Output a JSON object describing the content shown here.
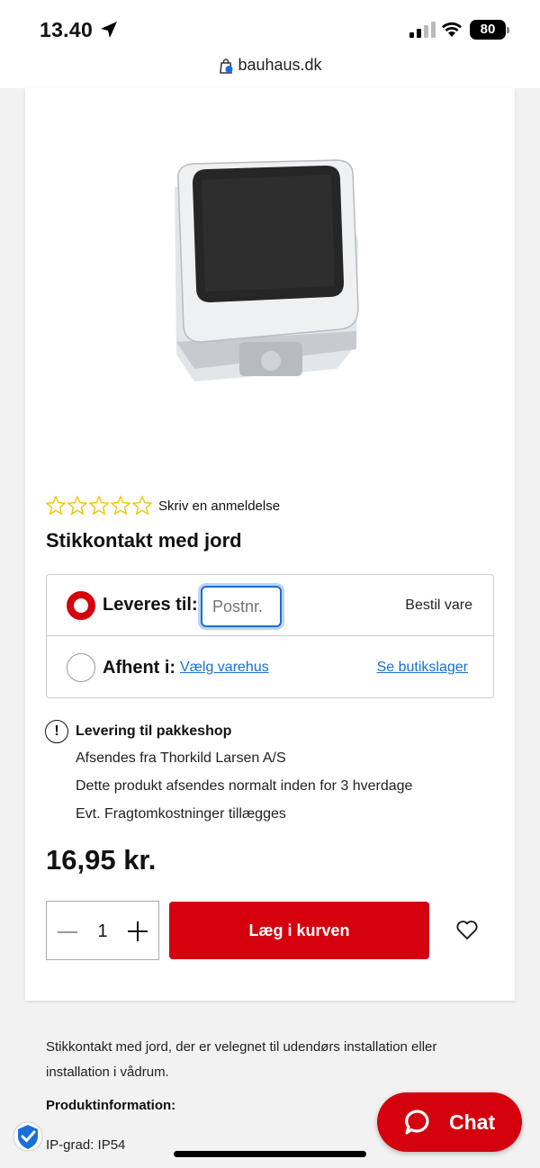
{
  "status_bar": {
    "time": "13.40",
    "battery": "80"
  },
  "browser": {
    "url": "bauhaus.dk"
  },
  "product": {
    "rating_stars": 0,
    "review_link": "Skriv en anmeldelse",
    "title": "Stikkontakt med jord",
    "price": "16,95 kr."
  },
  "delivery": {
    "deliver_label": "Leveres til:",
    "postcode_placeholder": "Postnr.",
    "order_label": "Bestil vare",
    "pickup_label": "Afhent i:",
    "choose_store_link": "Vælg varehus",
    "store_stock_link": "Se butikslager",
    "selected_option": "Leveres til:"
  },
  "shipping_info": {
    "title": "Levering til pakkeshop",
    "lines": [
      "Afsendes fra Thorkild Larsen A/S",
      "Dette produkt afsendes normalt inden for 3 hverdage",
      "Evt. Fragtomkostninger tillægges"
    ]
  },
  "purchase": {
    "quantity": "1",
    "add_to_cart_label": "Læg i kurven"
  },
  "description": {
    "text": "Stikkontakt med jord, der er velegnet til udendørs installation eller installation i vådrum.",
    "product_info_heading": "Produktinformation:",
    "ip_grade": "IP-grad: IP54"
  },
  "chat": {
    "label": "Chat"
  },
  "colors": {
    "brand_red": "#d4000e",
    "link_blue": "#1a6fd6",
    "star_yellow": "#f2c400"
  }
}
